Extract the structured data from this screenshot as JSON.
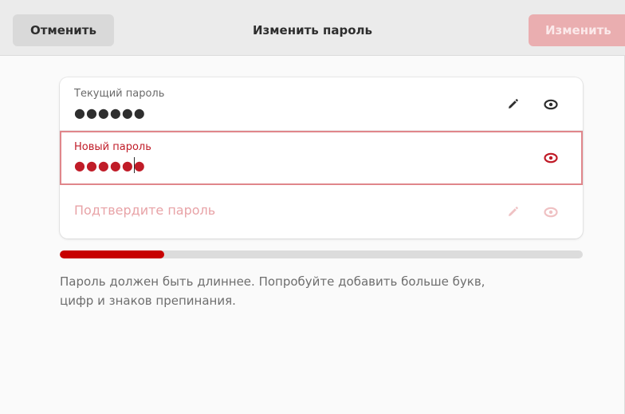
{
  "header": {
    "cancel_label": "Отменить",
    "title": "Изменить пароль",
    "apply_label": "Изменить"
  },
  "fields": {
    "current": {
      "label": "Текущий пароль",
      "masked_value": "●●●●●●",
      "icons": [
        "edit-pencil-icon",
        "show-password-eye-icon"
      ]
    },
    "new": {
      "label": "Новый пароль",
      "masked_value": "●●●●●●",
      "icons": [
        "show-password-eye-icon"
      ]
    },
    "confirm": {
      "placeholder": "Подтвердите пароль",
      "icons": [
        "edit-pencil-icon",
        "show-password-eye-icon"
      ]
    }
  },
  "strength": {
    "fraction": 0.2
  },
  "hint": "Пароль должен быть длиннее. Попробуйте добавить больше букв, цифр и знаков препинания.",
  "colors": {
    "accent_red": "#c01c28",
    "accent_red_light": "#e0868b",
    "apply_button_disabled": "#eaaeb0",
    "strength_fill": "#c70000",
    "header_bg": "#ebebeb"
  }
}
